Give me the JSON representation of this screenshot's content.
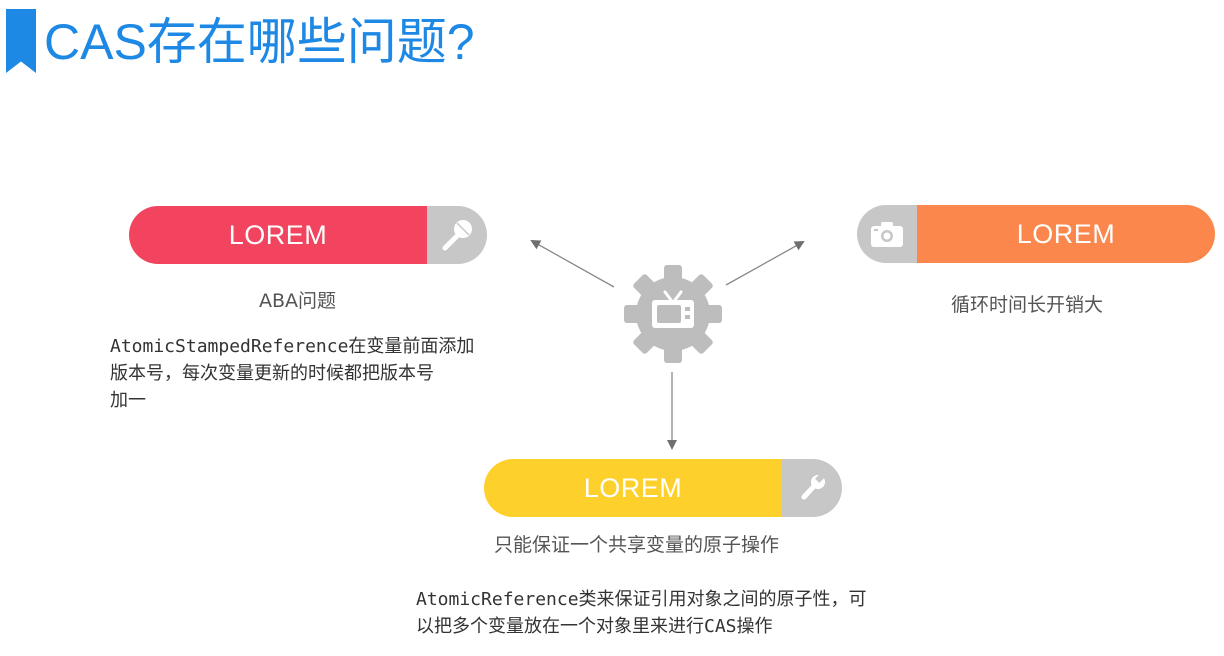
{
  "header": {
    "title": "CAS存在哪些问题?"
  },
  "center": {
    "icon": "gear-tv-icon"
  },
  "cards": {
    "left": {
      "label": "LOREM",
      "color": "#f2445f",
      "icon": "microphone-icon",
      "caption": "ABA问题",
      "lines": [
        "AtomicStampedReference在变量前面添加",
        "版本号，每次变量更新的时候都把版本号",
        "加一"
      ]
    },
    "right": {
      "label": "LOREM",
      "color": "#fb874c",
      "icon": "camera-icon",
      "caption": "循环时间长开销大"
    },
    "bottom": {
      "label": "LOREM",
      "color": "#fdd02b",
      "icon": "wrench-icon",
      "caption": "只能保证一个共享变量的原子操作",
      "lines": [
        "AtomicReference类来保证引用对象之间的原子性，可",
        "以把多个变量放在一个对象里来进行CAS操作"
      ]
    }
  }
}
